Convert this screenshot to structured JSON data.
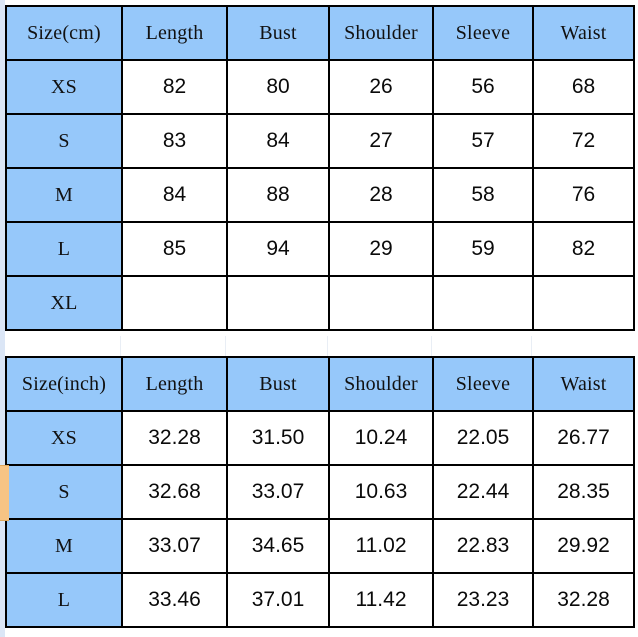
{
  "sheet": {
    "accent_blue": "#96c8fa",
    "marker_orange": "#f7c484",
    "grid_black": "#000000"
  },
  "tables": [
    {
      "id": "size-chart-cm",
      "unit": "cm",
      "headers": [
        "Size(cm)",
        "Length",
        "Bust",
        "Shoulder",
        "Sleeve",
        "Waist"
      ],
      "rows": [
        {
          "size": "XS",
          "values": [
            "82",
            "80",
            "26",
            "56",
            "68"
          ]
        },
        {
          "size": "S",
          "values": [
            "83",
            "84",
            "27",
            "57",
            "72"
          ]
        },
        {
          "size": "M",
          "values": [
            "84",
            "88",
            "28",
            "58",
            "76"
          ]
        },
        {
          "size": "L",
          "values": [
            "85",
            "94",
            "29",
            "59",
            "82"
          ]
        },
        {
          "size": "XL",
          "values": [
            "",
            "",
            "",
            "",
            ""
          ]
        }
      ]
    },
    {
      "id": "size-chart-inch",
      "unit": "inch",
      "headers": [
        "Size(inch)",
        "Length",
        "Bust",
        "Shoulder",
        "Sleeve",
        "Waist"
      ],
      "rows": [
        {
          "size": "XS",
          "values": [
            "32.28",
            "31.50",
            "10.24",
            "22.05",
            "26.77"
          ]
        },
        {
          "size": "S",
          "values": [
            "32.68",
            "33.07",
            "10.63",
            "22.44",
            "28.35"
          ]
        },
        {
          "size": "M",
          "values": [
            "33.07",
            "34.65",
            "11.02",
            "22.83",
            "29.92"
          ]
        },
        {
          "size": "L",
          "values": [
            "33.46",
            "37.01",
            "11.42",
            "23.23",
            "32.28"
          ]
        }
      ]
    }
  ],
  "row_marker": {
    "target_table": "size-chart-inch",
    "target_size": "S"
  }
}
